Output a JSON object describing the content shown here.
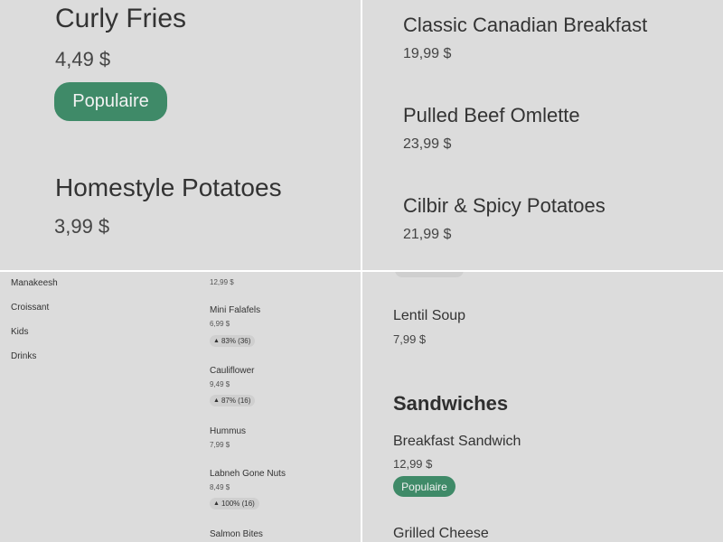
{
  "zoom_top_left": {
    "items": [
      {
        "name": "Curly Fries",
        "price": "4,49 $",
        "badge": "Populaire"
      },
      {
        "name": "Homestyle Potatoes",
        "price": "3,99 $"
      }
    ]
  },
  "zoom_top_right": {
    "items": [
      {
        "name": "Classic Canadian Breakfast",
        "price": "19,99 $"
      },
      {
        "name": "Pulled Beef Omlette",
        "price": "23,99 $"
      },
      {
        "name": "Cilbir & Spicy Potatoes",
        "price": "21,99 $"
      }
    ]
  },
  "menu_overview": {
    "categories": [
      "Manakeesh",
      "Croissant",
      "Kids",
      "Drinks"
    ],
    "top_price": "12,99 $",
    "items": [
      {
        "name": "Mini Falafels",
        "price": "6,99 $",
        "rating": "83% (36)"
      },
      {
        "name": "Cauliflower",
        "price": "9,49 $",
        "rating": "87% (16)"
      },
      {
        "name": "Hummus",
        "price": "7,99 $"
      },
      {
        "name": "Labneh Gone Nuts",
        "price": "8,49 $",
        "rating": "100% (16)"
      },
      {
        "name": "Salmon Bites"
      }
    ],
    "rating_fill_color": "#cfcfcf"
  },
  "zoom_bottom_right": {
    "items_before": [
      {
        "name": "Lentil Soup",
        "price": "7,99 $"
      }
    ],
    "section_title": "Sandwiches",
    "items": [
      {
        "name": "Breakfast Sandwich",
        "price": "12,99 $",
        "badge": "Populaire"
      },
      {
        "name": "Grilled Cheese"
      }
    ]
  },
  "colors": {
    "background": "#dcdcdc",
    "badge": "#3f8a68",
    "divider": "#ffffff"
  },
  "icons": {
    "rating": "thumbs-up-icon"
  }
}
